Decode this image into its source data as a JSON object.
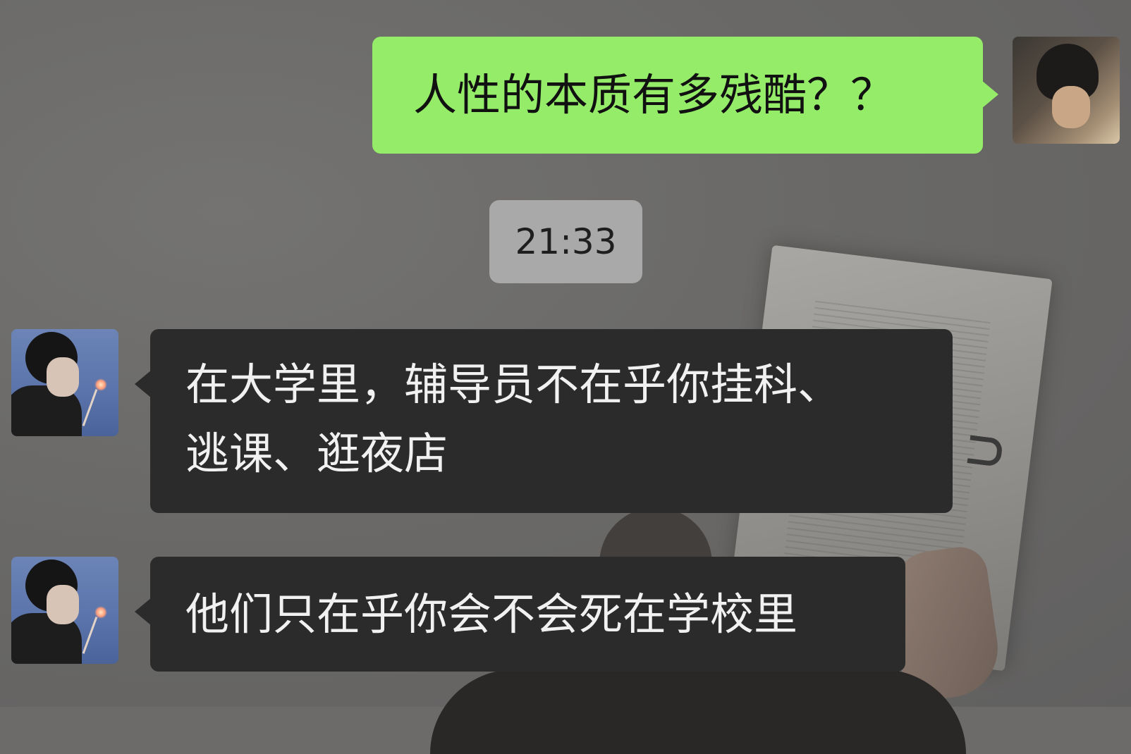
{
  "messages": [
    {
      "sender": "me",
      "text": "人性的本质有多残酷？？"
    },
    {
      "type": "time",
      "text": "21:33"
    },
    {
      "sender": "other",
      "lines": [
        "在大学里，辅导员不在乎你挂科、",
        "逃课、逛夜店"
      ]
    },
    {
      "sender": "other",
      "text": "他们只在乎你会不会死在学校里"
    }
  ],
  "colors": {
    "my_bubble": "#95ec69",
    "other_bubble": "#2b2b2b",
    "time_pill": "#a9a9a9"
  }
}
